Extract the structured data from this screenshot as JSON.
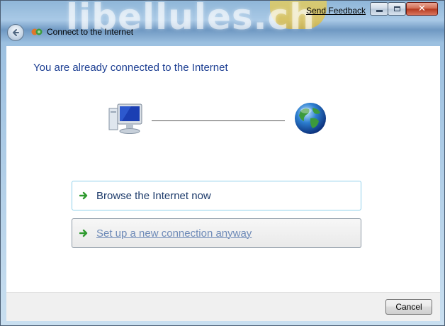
{
  "window": {
    "title": "Connect to the Internet",
    "background_watermark": "libellules.ch",
    "send_feedback": "Send Feedback",
    "caption_buttons": [
      "minimize",
      "maximize",
      "close"
    ]
  },
  "content": {
    "heading": "You are already connected to the Internet",
    "diagram": {
      "left_icon": "computer-icon",
      "right_icon": "globe-icon"
    },
    "commands": [
      {
        "label": "Browse the Internet now",
        "icon": "green-arrow-icon"
      },
      {
        "label": "Set up a new connection anyway",
        "icon": "green-arrow-icon"
      }
    ]
  },
  "footer": {
    "cancel_label": "Cancel"
  },
  "colors": {
    "heading": "#1c3e92",
    "link_hover_border": "#8fd0ea",
    "arrow": "#2e9a2e"
  }
}
